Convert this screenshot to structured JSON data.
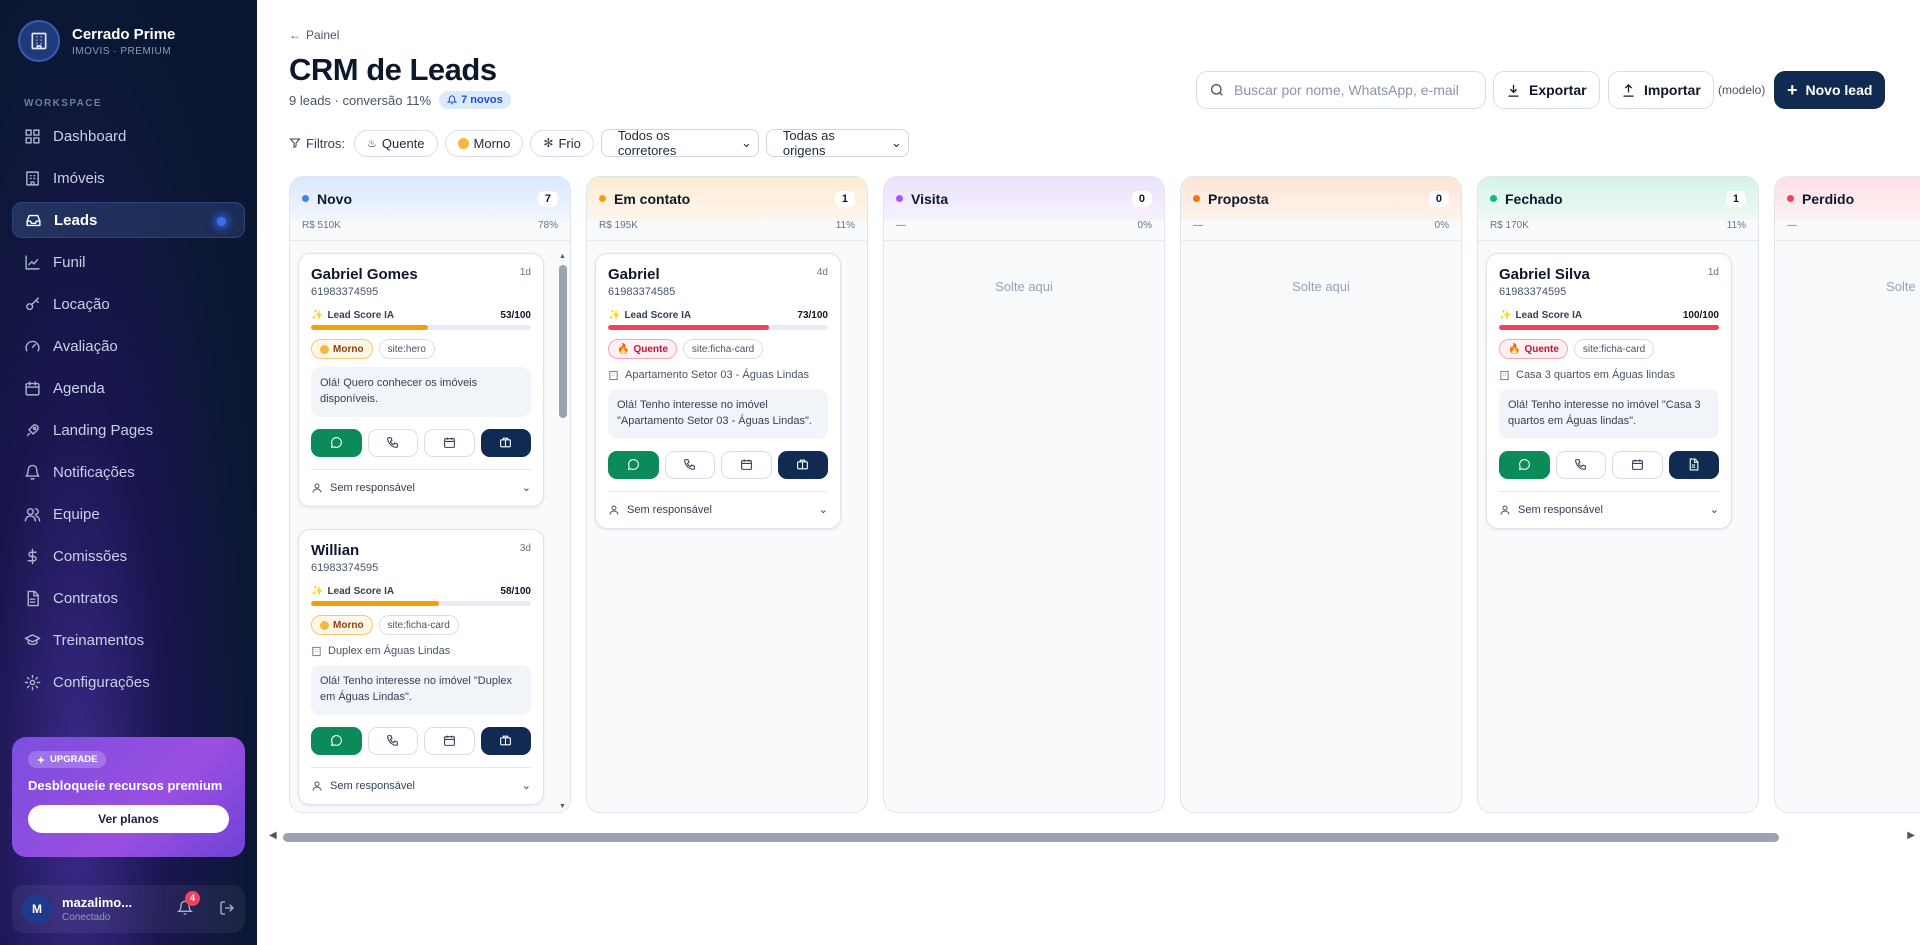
{
  "brand": {
    "name": "Cerrado Prime",
    "sub": "IMOVIS · PREMIUM"
  },
  "workspace_label": "WORKSPACE",
  "nav": [
    {
      "label": "Dashboard",
      "icon": "grid-icon"
    },
    {
      "label": "Imóveis",
      "icon": "building-icon"
    },
    {
      "label": "Leads",
      "icon": "inbox-icon",
      "active": true
    },
    {
      "label": "Funil",
      "icon": "chart-line-icon"
    },
    {
      "label": "Locação",
      "icon": "key-icon"
    },
    {
      "label": "Avaliação",
      "icon": "gauge-icon"
    },
    {
      "label": "Agenda",
      "icon": "calendar-icon"
    },
    {
      "label": "Landing Pages",
      "icon": "rocket-icon"
    },
    {
      "label": "Notificações",
      "icon": "bell-icon"
    },
    {
      "label": "Equipe",
      "icon": "users-icon"
    },
    {
      "label": "Comissões",
      "icon": "dollar-icon"
    },
    {
      "label": "Contratos",
      "icon": "document-icon"
    },
    {
      "label": "Treinamentos",
      "icon": "graduation-cap-icon"
    },
    {
      "label": "Configurações",
      "icon": "gear-icon"
    }
  ],
  "upgrade": {
    "badge": "UPGRADE",
    "text": "Desbloqueie recursos premium",
    "button": "Ver planos"
  },
  "user": {
    "initial": "M",
    "name": "mazalimo...",
    "status": "Conectado",
    "notifications": "4"
  },
  "header": {
    "back": "Painel",
    "title": "CRM de Leads",
    "subtitle": "9 leads · conversão 11%",
    "new_badge": "7 novos",
    "search_placeholder": "Buscar por nome, WhatsApp, e-mail",
    "export": "Exportar",
    "import": "Importar",
    "modelo": "(modelo)",
    "new_lead": "Novo lead"
  },
  "filters": {
    "label": "Filtros:",
    "chips": [
      "Quente",
      "Morno",
      "Frio"
    ],
    "brokers": "Todos os corretores",
    "origins": "Todas as origens"
  },
  "colors": {
    "novo": "#3b82f6",
    "contato": "#f59e0b",
    "visita": "#a855f7",
    "proposta": "#f97316",
    "fechado": "#10b981",
    "perdido": "#f43f5e"
  },
  "columns": {
    "novo": {
      "name": "Novo",
      "count": "7",
      "value": "R$ 510K",
      "pct": "78%"
    },
    "contato": {
      "name": "Em contato",
      "count": "1",
      "value": "R$ 195K",
      "pct": "11%"
    },
    "visita": {
      "name": "Visita",
      "count": "0",
      "value": "—",
      "pct": "0%",
      "drop": "Solte aqui"
    },
    "proposta": {
      "name": "Proposta",
      "count": "0",
      "value": "—",
      "pct": "0%",
      "drop": "Solte aqui"
    },
    "fechado": {
      "name": "Fechado",
      "count": "1",
      "value": "R$ 170K",
      "pct": "11%"
    },
    "perdido": {
      "name": "Perdido",
      "count": "",
      "value": "—",
      "pct": "",
      "drop": "Solte aqui"
    }
  },
  "score_label": "Lead Score IA",
  "owner_label": "Sem responsável",
  "cards": {
    "c1": {
      "name": "Gabriel Gomes",
      "phone": "61983374595",
      "age": "1d",
      "score": "53/100",
      "score_value": 53,
      "temp": "Morno",
      "source": "site:hero",
      "message": "Olá! Quero conhecer os imóveis disponíveis."
    },
    "c2": {
      "name": "Willian",
      "phone": "61983374595",
      "age": "3d",
      "score": "58/100",
      "score_value": 58,
      "temp": "Morno",
      "source": "site:ficha-card",
      "property": "Duplex em Águas Lindas",
      "message": "Olá! Tenho interesse no imóvel \"Duplex em Águas Lindas\"."
    },
    "c3": {
      "name": "Gabriel",
      "phone": "61983374585",
      "age": "4d",
      "score": "73/100",
      "score_value": 73,
      "temp": "Quente",
      "source": "site:ficha-card",
      "property": "Apartamento Setor 03 - Águas Lindas",
      "message": "Olá! Tenho interesse no imóvel \"Apartamento Setor 03 - Águas Lindas\"."
    },
    "c4": {
      "name": "Gabriel Silva",
      "phone": "61983374595",
      "age": "1d",
      "score": "100/100",
      "score_value": 100,
      "temp": "Quente",
      "source": "site:ficha-card",
      "property": "Casa 3 quartos em Águas lindas",
      "message": "Olá! Tenho interesse no imóvel \"Casa 3 quartos em Águas lindas\"."
    }
  }
}
